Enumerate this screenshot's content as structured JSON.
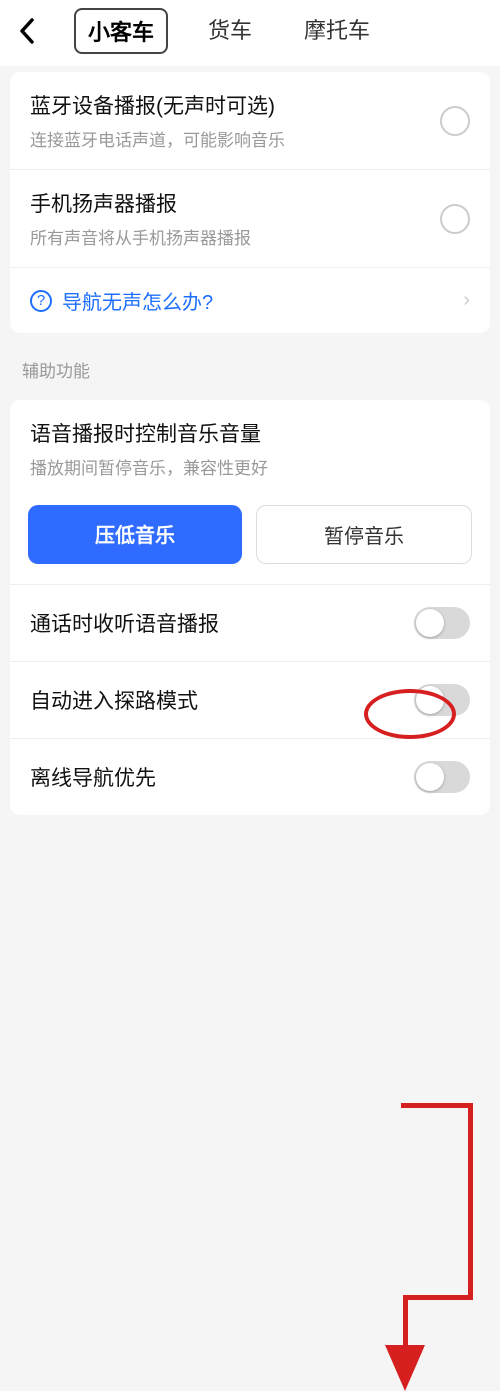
{
  "header": {
    "tabs": [
      "小客车",
      "货车",
      "摩托车"
    ],
    "active_tab": "小客车"
  },
  "card1": {
    "items": [
      {
        "title": "蓝牙设备播报(无声时可选)",
        "sub": "连接蓝牙电话声道，可能影响音乐"
      },
      {
        "title": "手机扬声器播报",
        "sub": "所有声音将从手机扬声器播报"
      }
    ],
    "help": "导航无声怎么办?"
  },
  "section_title": "辅助功能",
  "music_card": {
    "title": "语音播报时控制音乐音量",
    "sub": "播放期间暂停音乐，兼容性更好",
    "options": [
      "压低音乐",
      "暂停音乐"
    ],
    "active_option": "压低音乐",
    "toggles": [
      {
        "label": "通话时收听语音播报"
      },
      {
        "label": "自动进入探路模式"
      },
      {
        "label": "离线导航优先"
      }
    ]
  },
  "annotation": {
    "highlighted_element": "自动进入探路模式",
    "color": "#d62020"
  }
}
